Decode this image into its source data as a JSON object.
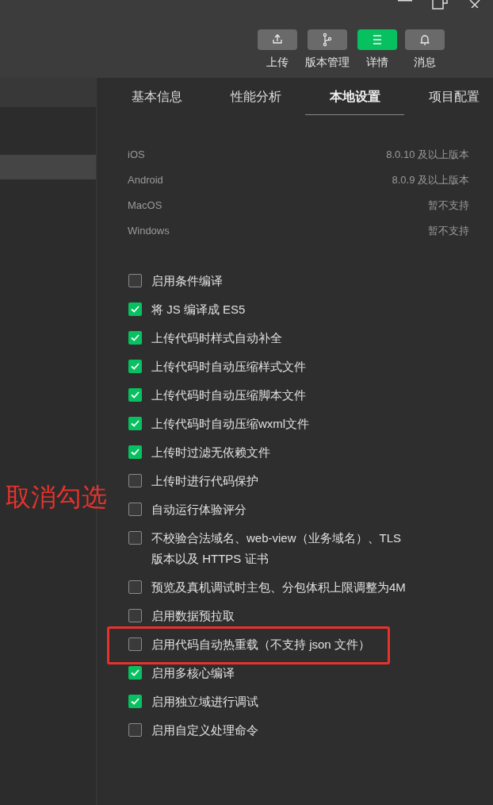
{
  "toolbar": [
    {
      "kind": "upload",
      "label": "上传",
      "selected": false
    },
    {
      "kind": "branch",
      "label": "版本管理",
      "selected": false
    },
    {
      "kind": "menu",
      "label": "详情",
      "selected": true
    },
    {
      "kind": "bell",
      "label": "消息",
      "selected": false
    }
  ],
  "tabs": [
    {
      "label": "基本信息",
      "selected": false
    },
    {
      "label": "性能分析",
      "selected": false
    },
    {
      "label": "本地设置",
      "selected": true
    },
    {
      "label": "项目配置",
      "selected": false
    }
  ],
  "versions": [
    {
      "platform": "iOS",
      "value": "8.0.10 及以上版本"
    },
    {
      "platform": "Android",
      "value": "8.0.9 及以上版本"
    },
    {
      "platform": "MacOS",
      "value": "暂不支持"
    },
    {
      "platform": "Windows",
      "value": "暂不支持"
    }
  ],
  "options": [
    {
      "label": "启用条件编译",
      "checked": false
    },
    {
      "label": "将 JS 编译成 ES5",
      "checked": true
    },
    {
      "label": "上传代码时样式自动补全",
      "checked": true
    },
    {
      "label": "上传代码时自动压缩样式文件",
      "checked": true
    },
    {
      "label": "上传代码时自动压缩脚本文件",
      "checked": true
    },
    {
      "label": "上传代码时自动压缩wxml文件",
      "checked": true
    },
    {
      "label": "上传时过滤无依赖文件",
      "checked": true
    },
    {
      "label": "上传时进行代码保护",
      "checked": false
    },
    {
      "label": "自动运行体验评分",
      "checked": false
    },
    {
      "label": "不校验合法域名、web-view（业务域名）、TLS 版本以及 HTTPS 证书",
      "checked": false
    },
    {
      "label": "预览及真机调试时主包、分包体积上限调整为4M",
      "checked": false
    },
    {
      "label": "启用数据预拉取",
      "checked": false
    },
    {
      "label": "启用代码自动热重载（不支持 json 文件）",
      "checked": false,
      "highlighted": true
    },
    {
      "label": "启用多核心编译",
      "checked": true
    },
    {
      "label": "启用独立域进行调试",
      "checked": true
    },
    {
      "label": "启用自定义处理命令",
      "checked": false
    }
  ],
  "annotation": {
    "text": "取消勾选"
  }
}
